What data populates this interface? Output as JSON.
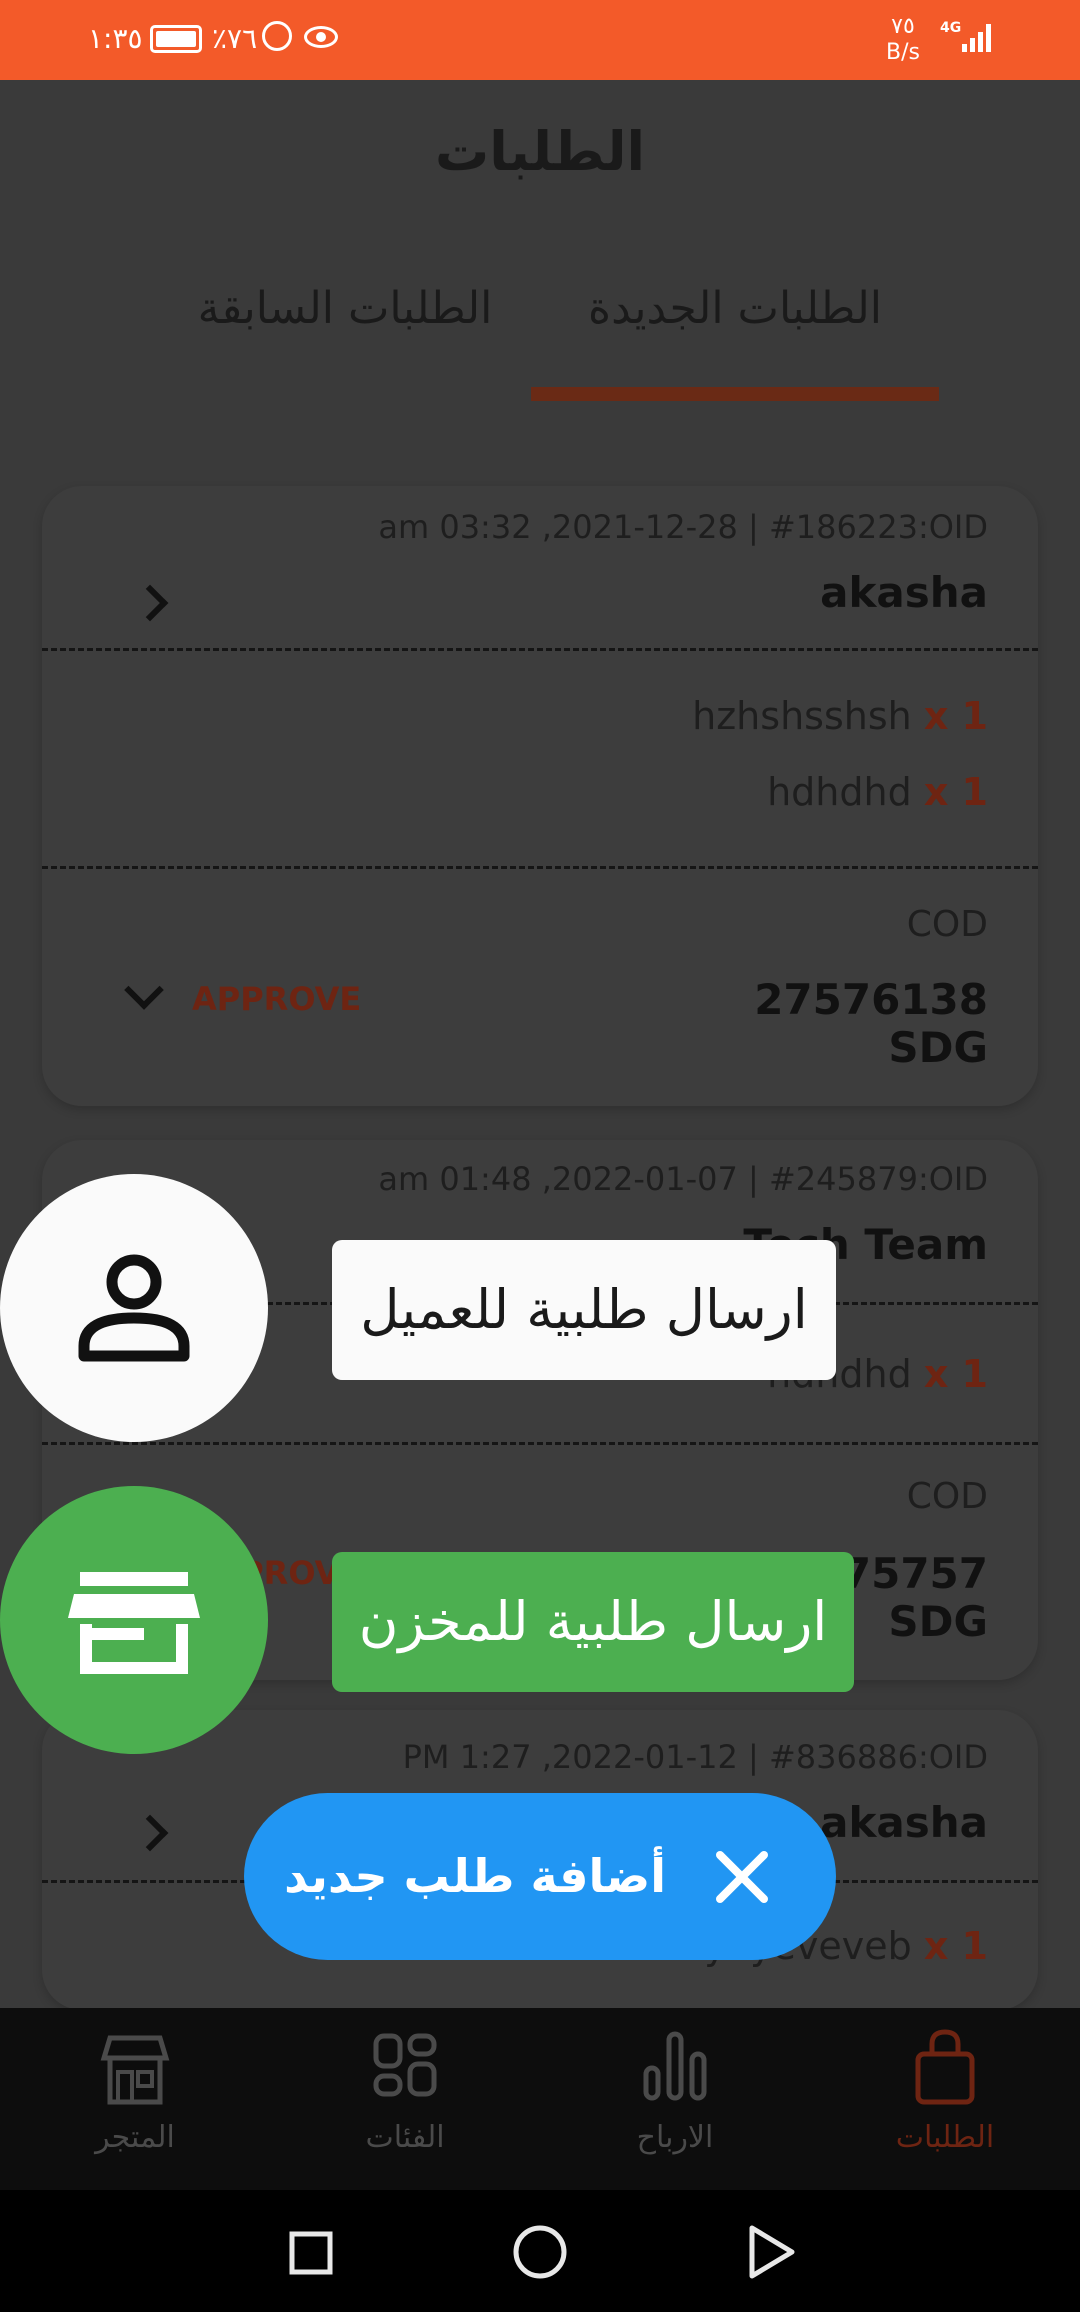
{
  "status_bar": {
    "time": "١:٣٥",
    "battery": "٪٧٦",
    "speed_value": "٧٥",
    "speed_unit": "B/s",
    "network": "4G"
  },
  "header": {
    "title": "الطلبات",
    "tabs": [
      {
        "label": "الطلبات الجديدة",
        "active": true
      },
      {
        "label": "الطلبات السابقة",
        "active": false
      }
    ]
  },
  "orders": [
    {
      "meta": "am 03:32 ,2021-12-28 | #186223:OID",
      "customer": "akasha",
      "items": [
        {
          "qty": "x 1",
          "name": "hzhshsshsh"
        },
        {
          "qty": "x 1",
          "name": "hdhdhd"
        }
      ],
      "payment": "COD",
      "amount_line1": "27576138",
      "amount_line2": "SDG",
      "action": "APPROVE"
    },
    {
      "meta": "am 01:48 ,2022-01-07 | #245879:OID",
      "customer": "Tech Team",
      "items": [
        {
          "qty": "x 1",
          "name": "hdhdhd"
        }
      ],
      "payment": "COD",
      "amount_line1": "75757",
      "amount_line2": "SDG",
      "action": "APPROVE"
    },
    {
      "meta": "PM 1:27 ,2022-01-12 | #836886:OID",
      "customer": "akasha",
      "items": [
        {
          "qty": "x 1",
          "name": "eyeyeveveb"
        }
      ]
    }
  ],
  "fab_menu": {
    "send_to_customer": "ارسال طلبية للعميل",
    "send_to_store": "ارسال طلبية للمخزن",
    "main_label": "أضافة طلب جديد"
  },
  "bottom_nav": [
    {
      "label": "المتجر",
      "icon": "store-icon",
      "active": false
    },
    {
      "label": "الفئات",
      "icon": "grid-icon",
      "active": false
    },
    {
      "label": "الارباح",
      "icon": "bar-chart-icon",
      "active": false
    },
    {
      "label": "الطلبات",
      "icon": "shopping-bag-icon",
      "active": true
    }
  ],
  "colors": {
    "status_bar": "#f35a29",
    "overlay_background": "#3a3a3a",
    "tab_indicator": "#6a2a15",
    "accent_quantity": "#6e2412",
    "fab_store": "#4caf50",
    "fab_main": "#2196f3",
    "nav_background": "#0d0d0d"
  }
}
